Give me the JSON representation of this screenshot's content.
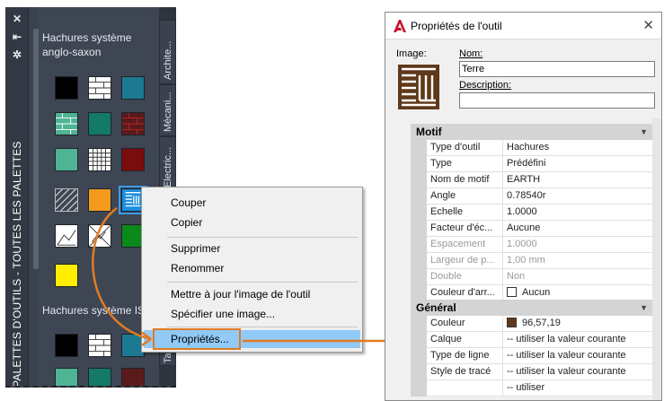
{
  "palette": {
    "vertical_title": "PALETTES D'OUTILS - TOUTES LES PALETTES",
    "controls": [
      "close-icon",
      "autohide-icon",
      "properties-icon"
    ],
    "section1_title_line1": "Hachures système",
    "section1_title_line2": "anglo-saxon",
    "section2_title": "Hachures système ISO",
    "tabs": [
      "Archite...",
      "Mécani...",
      "Electric...",
      "Ta"
    ]
  },
  "context_menu": {
    "items": [
      "Couper",
      "Copier",
      "Supprimer",
      "Renommer",
      "Mettre à jour l'image de l'outil",
      "Spécifier une image...",
      "Propriétés..."
    ],
    "highlighted_index": 6
  },
  "dialog": {
    "title": "Propriétés de l'outil",
    "close_glyph": "✕",
    "image_label": "Image:",
    "name_label": "Nom:",
    "name_value": "Terre",
    "description_label": "Description:",
    "description_value": "",
    "group_motif": "Motif",
    "motif_rows": [
      {
        "name": "Type d'outil",
        "value": "Hachures"
      },
      {
        "name": "Type",
        "value": "Prédéfini"
      },
      {
        "name": "Nom de motif",
        "value": "EARTH"
      },
      {
        "name": "Angle",
        "value": "0.78540r"
      },
      {
        "name": "Echelle",
        "value": "1.0000"
      },
      {
        "name": "Facteur d'éc...",
        "value": "Aucune"
      },
      {
        "name": "Espacement",
        "value": "1.0000"
      },
      {
        "name": "Largeur de p...",
        "value": "1,00 mm"
      },
      {
        "name": "Double",
        "value": "Non"
      },
      {
        "name": "Couleur d'arr...",
        "value": "Aucun"
      }
    ],
    "group_general": "Général",
    "general_rows": [
      {
        "name": "Couleur",
        "value": "96,57,19"
      },
      {
        "name": "Calque",
        "value": "-- utiliser la valeur courante"
      },
      {
        "name": "Type de ligne",
        "value": "-- utiliser la valeur courante"
      },
      {
        "name": "Style de tracé",
        "value": "-- utiliser la valeur courante"
      },
      {
        "name": "",
        "value": "-- utiliser"
      }
    ]
  },
  "colors": {
    "accent_orange": "#e07b22",
    "menu_highlight": "#91c9f7",
    "earth_brown": "#60391a"
  }
}
